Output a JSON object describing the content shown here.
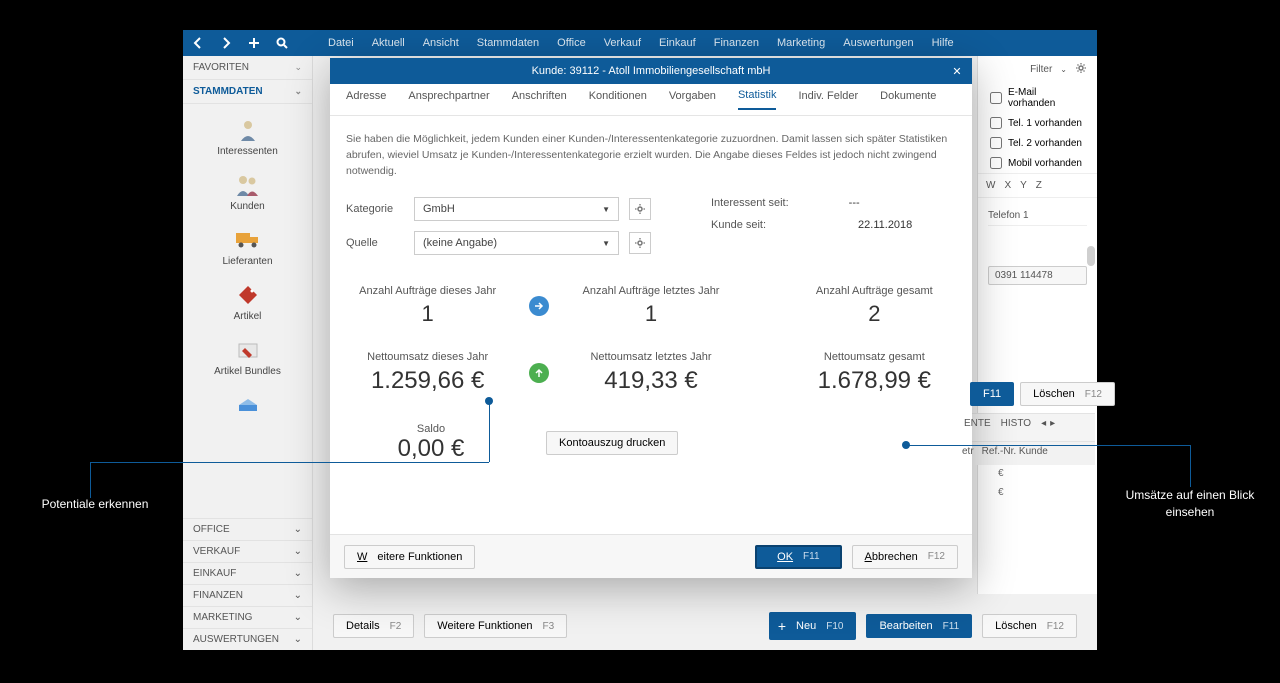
{
  "menu": [
    "Datei",
    "Aktuell",
    "Ansicht",
    "Stammdaten",
    "Office",
    "Verkauf",
    "Einkauf",
    "Finanzen",
    "Marketing",
    "Auswertungen",
    "Hilfe"
  ],
  "sidebar": {
    "favoriten": "FAVORITEN",
    "stammdaten": "STAMMDATEN",
    "items": [
      {
        "label": "Interessenten"
      },
      {
        "label": "Kunden"
      },
      {
        "label": "Lieferanten"
      },
      {
        "label": "Artikel"
      },
      {
        "label": "Artikel Bundles"
      }
    ],
    "bottom": [
      "OFFICE",
      "VERKAUF",
      "EINKAUF",
      "FINANZEN",
      "MARKETING",
      "AUSWERTUNGEN"
    ]
  },
  "rightpanel": {
    "filter": "Filter",
    "checks": [
      "E-Mail vorhanden",
      "Tel. 1 vorhanden",
      "Tel. 2 vorhanden",
      "Mobil vorhanden"
    ],
    "letters": [
      "W",
      "X",
      "Y",
      "Z"
    ],
    "col": "Telefon 1",
    "phone": "0391 114478"
  },
  "bgmid": {
    "f11": "F11",
    "loeschen": "Löschen",
    "f12": "F12",
    "tabs": [
      "ENTE",
      "HISTO"
    ],
    "cols": [
      "etr",
      "Ref.-Nr. Kunde"
    ],
    "euro": "€"
  },
  "bottom": {
    "details": "Details",
    "f2": "F2",
    "wf": "Weitere Funktionen",
    "f3": "F3",
    "neu": "Neu",
    "f10": "F10",
    "bearbeiten": "Bearbeiten",
    "f11": "F11",
    "loeschen": "Löschen",
    "f12": "F12"
  },
  "modal": {
    "title": "Kunde: 39112 - Atoll Immobiliengesellschaft mbH",
    "tabs": [
      "Adresse",
      "Ansprechpartner",
      "Anschriften",
      "Konditionen",
      "Vorgaben",
      "Statistik",
      "Indiv. Felder",
      "Dokumente"
    ],
    "active_tab": "Statistik",
    "desc": "Sie haben die Möglichkeit, jedem Kunden einer Kunden-/Interessentenkategorie zuzuordnen. Damit lassen sich später Statistiken abrufen, wieviel Umsatz je Kunden-/Interessentenkategorie erzielt wurden. Die Angabe dieses Feldes ist jedoch nicht zwingend notwendig.",
    "kategorie_lbl": "Kategorie",
    "kategorie_val": "GmbH",
    "quelle_lbl": "Quelle",
    "quelle_val": "(keine Angabe)",
    "interessent_lbl": "Interessent seit:",
    "interessent_val": "---",
    "kunde_lbl": "Kunde seit:",
    "kunde_val": "22.11.2018",
    "stats": {
      "a_this_lbl": "Anzahl Aufträge dieses Jahr",
      "a_this": "1",
      "a_last_lbl": "Anzahl Aufträge letztes Jahr",
      "a_last": "1",
      "a_tot_lbl": "Anzahl Aufträge gesamt",
      "a_tot": "2",
      "n_this_lbl": "Nettoumsatz dieses Jahr",
      "n_this": "1.259,66 €",
      "n_last_lbl": "Nettoumsatz letztes Jahr",
      "n_last": "419,33 €",
      "n_tot_lbl": "Nettoumsatz gesamt",
      "n_tot": "1.678,99 €",
      "saldo_lbl": "Saldo",
      "saldo": "0,00 €"
    },
    "kontoauszug": "Kontoauszug drucken",
    "wf": "Weitere Funktionen",
    "ok": "OK",
    "ok_fk": "F11",
    "abbrechen": "Abbrechen",
    "ab_fk": "F12"
  },
  "anno": {
    "left": "Potentiale erkennen",
    "right": "Umsätze auf einen Blick einsehen"
  }
}
